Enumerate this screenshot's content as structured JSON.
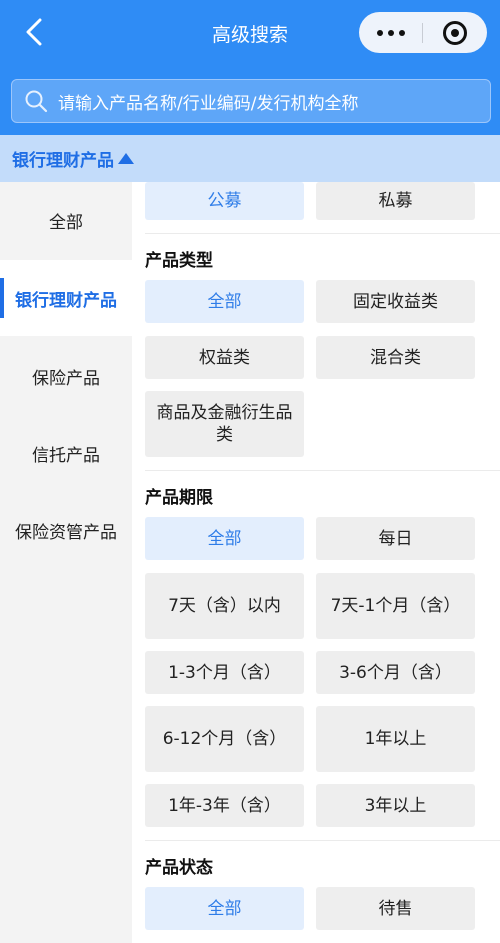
{
  "header": {
    "title": "高级搜索"
  },
  "search": {
    "placeholder": "请输入产品名称/行业编码/发行机构全称"
  },
  "category_bar": {
    "label": "银行理财产品"
  },
  "sidebar": {
    "items": [
      {
        "label": "全部"
      },
      {
        "label": "银行理财产品"
      },
      {
        "label": "保险产品"
      },
      {
        "label": "信托产品"
      },
      {
        "label": "保险资管产品"
      }
    ]
  },
  "raise_method": {
    "options": [
      {
        "label": "公募"
      },
      {
        "label": "私募"
      }
    ]
  },
  "product_type": {
    "title": "产品类型",
    "options": [
      {
        "label": "全部"
      },
      {
        "label": "固定收益类"
      },
      {
        "label": "权益类"
      },
      {
        "label": "混合类"
      },
      {
        "label": "商品及金融衍生品类"
      }
    ]
  },
  "product_term": {
    "title": "产品期限",
    "options": [
      {
        "label": "全部"
      },
      {
        "label": "每日"
      },
      {
        "label": "7天（含）以内"
      },
      {
        "label": "7天-1个月（含）"
      },
      {
        "label": "1-3个月（含）"
      },
      {
        "label": "3-6个月（含）"
      },
      {
        "label": "6-12个月（含）"
      },
      {
        "label": "1年以上"
      },
      {
        "label": "1年-3年（含）"
      },
      {
        "label": "3年以上"
      }
    ]
  },
  "product_status": {
    "title": "产品状态",
    "options": [
      {
        "label": "全部"
      },
      {
        "label": "待售"
      }
    ]
  },
  "colors": {
    "header_bg": "#2f8cf5",
    "accent": "#1f6ee5",
    "selected_chip_bg": "#e3eefd",
    "chip_bg": "#eeeeee",
    "sidebar_bg": "#f3f3f3"
  },
  "icons": [
    "back-arrow-icon",
    "more-dots-icon",
    "target-icon",
    "search-icon",
    "triangle-up-icon"
  ]
}
